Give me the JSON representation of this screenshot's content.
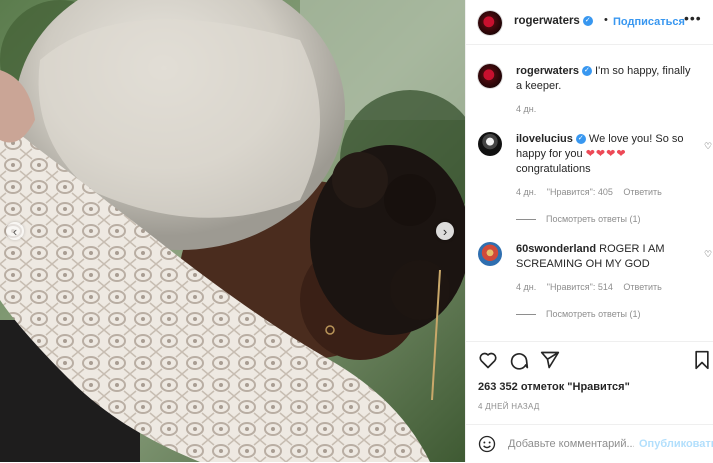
{
  "photo": {
    "prev_icon": "chevron-left-icon",
    "next_icon": "chevron-right-icon"
  },
  "header": {
    "username": "rogerwaters",
    "verified_icon": "verified-badge-icon",
    "separator": "•",
    "follow_label": "Подписаться",
    "more_icon": "more-options-icon"
  },
  "caption": {
    "username": "rogerwaters",
    "text": " I'm so happy, finally a keeper.",
    "time": "4 дн."
  },
  "comments": [
    {
      "username": "ilovelucius",
      "text": " We love you! So so happy for you ",
      "emoji": "❤❤❤❤",
      "text_after": " congratulations",
      "time": "4 дн.",
      "likes": "\"Нравится\": 405",
      "reply": "Ответить",
      "view_replies": "Посмотреть ответы (1)"
    },
    {
      "username": "60swonderland",
      "text": " ROGER I AM SCREAMING OH MY GOD",
      "time": "4 дн.",
      "likes": "\"Нравится\": 514",
      "reply": "Ответить",
      "view_replies": "Посмотреть ответы (1)"
    }
  ],
  "actions": {
    "like_icon": "heart-icon",
    "comment_icon": "comment-icon",
    "share_icon": "share-icon",
    "save_icon": "bookmark-icon"
  },
  "likes_text": "263 352 отметок \"Нравится\"",
  "post_date": "4 ДНЕЙ НАЗАД",
  "add_comment": {
    "placeholder": "Добавьте комментарий...",
    "publish_label": "Опубликовать",
    "emoji_icon": "smiley-icon"
  },
  "colors": {
    "accent": "#3897f0",
    "publish_disabled": "#b2dffc",
    "like_red": "#ed4956",
    "muted": "#8e8e8e"
  }
}
